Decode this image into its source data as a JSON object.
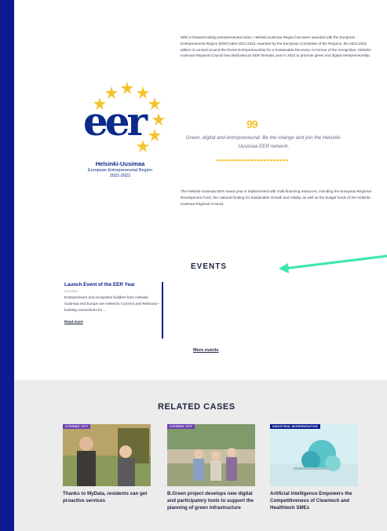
{
  "logo": {
    "mark": "eer",
    "title": "Helsinki-Uusimaa",
    "subtitle_line1": "European Entrepreneurial Region",
    "subtitle_line2": "2021-2022",
    "star_color": "#f4c430",
    "brand_color": "#0b2a8a"
  },
  "intro_text": "With a forward-looking entrepreneurial vision, Helsinki-Uusimaa Region has been awarded with the European Entrepreneurial Region (EER) label 2021-2022. Awarded by the European Committee of the Regions, the 2021-2022 edition is centred around the theme Entrepreneurship for a Sustainable Recovery. In honour of the recognition, Helsinki-Uusimaa Regional Council has dedicated an EER thematic year in 2022 to promote green and digital entrepreneurship.",
  "quote": {
    "mark": "99",
    "text": "Green, digital and entrepreneurial. Be the change and join the Helsinki-Uusimaa EER network."
  },
  "funding_text": "The Helsinki-Uusimaa EER Award year is implemented with multi-financing resources, including the European Regional Development Fund, the national funding for Sustainable Growth and Vitality, as well as the budget funds of the Helsinki-Uusimaa Regional Council.",
  "events": {
    "title": "EVENTS",
    "items": [
      {
        "title": "Launch Event of the EER Year",
        "date": "3.11.2021",
        "description": "Entrepreneurs and ecosystem builders from Helsinki-Uusimaa and Europe are invited to Connect and Rebound – building connections for ...",
        "read_more": "Read more"
      }
    ],
    "more_label": "More events"
  },
  "related": {
    "title": "RELATED CASES",
    "cases": [
      {
        "tag": "CITIZENS' CITY",
        "title": "Thanks to MyData, residents can get proactive services"
      },
      {
        "tag": "CITIZENS' CITY",
        "title": "B.Green project develops new digital and participatory tools to support the planning of green infrastructure"
      },
      {
        "tag": "INDUSTRIAL MODERNISATION",
        "title": "Artificial Intelligence Empowers the Competitiveness of Cleantech and Healthtech SMEs"
      }
    ]
  },
  "colors": {
    "frame": "#0b1b8f",
    "accent_yellow": "#f4c430",
    "arrow": "#3ee6b0",
    "tag_purple": "#6a3fb2",
    "tag_navy": "#0b1b8f"
  },
  "icons": [
    "eu-stars-icon",
    "quote-icon",
    "arrow-icon"
  ]
}
